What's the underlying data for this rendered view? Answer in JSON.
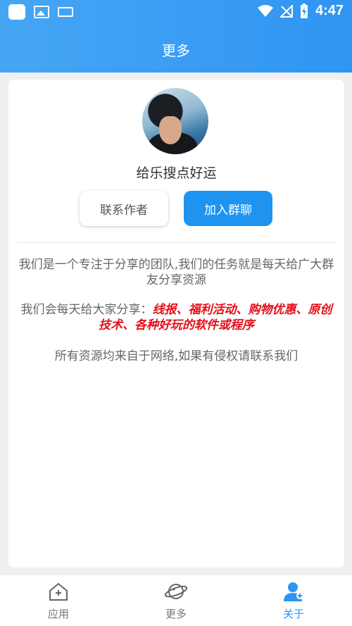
{
  "status_bar": {
    "time": "4:47"
  },
  "header": {
    "title": "更多"
  },
  "profile": {
    "name": "给乐搜点好运"
  },
  "buttons": {
    "contact": "联系作者",
    "join": "加入群聊"
  },
  "intro": {
    "line1": "我们是一个专注于分享的团队,我们的任务就是每天给广大群友分享资源",
    "line2_prefix": "我们会每天给大家分享：",
    "line2_highlight": "线报、福利活动、购物优惠、原创技术、各种好玩的软件或程序",
    "line3": "所有资源均来自于网络,如果有侵权请联系我们"
  },
  "tabs": [
    {
      "label": "应用",
      "icon": "home-plus-icon"
    },
    {
      "label": "更多",
      "icon": "planet-icon"
    },
    {
      "label": "关于",
      "icon": "user-icon"
    }
  ],
  "colors": {
    "accent": "#2f95f2",
    "highlight": "#e3101a"
  }
}
